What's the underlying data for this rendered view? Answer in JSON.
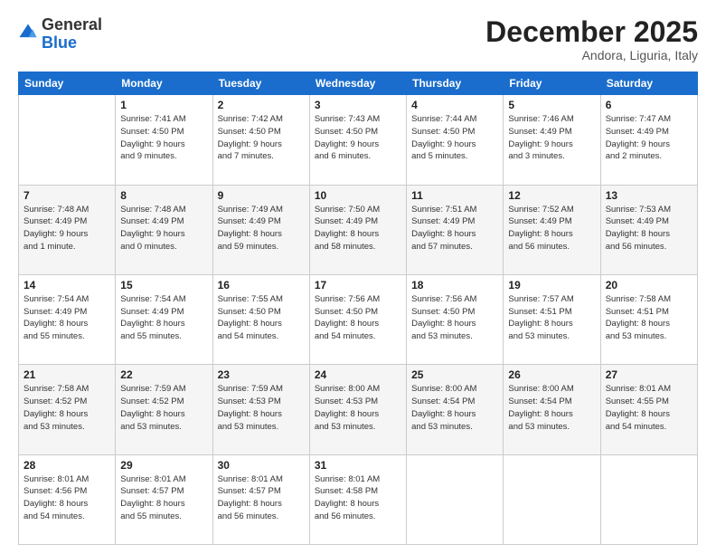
{
  "header": {
    "logo": {
      "general": "General",
      "blue": "Blue"
    },
    "title": "December 2025",
    "subtitle": "Andora, Liguria, Italy"
  },
  "calendar": {
    "days_of_week": [
      "Sunday",
      "Monday",
      "Tuesday",
      "Wednesday",
      "Thursday",
      "Friday",
      "Saturday"
    ],
    "weeks": [
      [
        {
          "day": "",
          "info": ""
        },
        {
          "day": "1",
          "info": "Sunrise: 7:41 AM\nSunset: 4:50 PM\nDaylight: 9 hours\nand 9 minutes."
        },
        {
          "day": "2",
          "info": "Sunrise: 7:42 AM\nSunset: 4:50 PM\nDaylight: 9 hours\nand 7 minutes."
        },
        {
          "day": "3",
          "info": "Sunrise: 7:43 AM\nSunset: 4:50 PM\nDaylight: 9 hours\nand 6 minutes."
        },
        {
          "day": "4",
          "info": "Sunrise: 7:44 AM\nSunset: 4:50 PM\nDaylight: 9 hours\nand 5 minutes."
        },
        {
          "day": "5",
          "info": "Sunrise: 7:46 AM\nSunset: 4:49 PM\nDaylight: 9 hours\nand 3 minutes."
        },
        {
          "day": "6",
          "info": "Sunrise: 7:47 AM\nSunset: 4:49 PM\nDaylight: 9 hours\nand 2 minutes."
        }
      ],
      [
        {
          "day": "7",
          "info": "Sunrise: 7:48 AM\nSunset: 4:49 PM\nDaylight: 9 hours\nand 1 minute."
        },
        {
          "day": "8",
          "info": "Sunrise: 7:48 AM\nSunset: 4:49 PM\nDaylight: 9 hours\nand 0 minutes."
        },
        {
          "day": "9",
          "info": "Sunrise: 7:49 AM\nSunset: 4:49 PM\nDaylight: 8 hours\nand 59 minutes."
        },
        {
          "day": "10",
          "info": "Sunrise: 7:50 AM\nSunset: 4:49 PM\nDaylight: 8 hours\nand 58 minutes."
        },
        {
          "day": "11",
          "info": "Sunrise: 7:51 AM\nSunset: 4:49 PM\nDaylight: 8 hours\nand 57 minutes."
        },
        {
          "day": "12",
          "info": "Sunrise: 7:52 AM\nSunset: 4:49 PM\nDaylight: 8 hours\nand 56 minutes."
        },
        {
          "day": "13",
          "info": "Sunrise: 7:53 AM\nSunset: 4:49 PM\nDaylight: 8 hours\nand 56 minutes."
        }
      ],
      [
        {
          "day": "14",
          "info": "Sunrise: 7:54 AM\nSunset: 4:49 PM\nDaylight: 8 hours\nand 55 minutes."
        },
        {
          "day": "15",
          "info": "Sunrise: 7:54 AM\nSunset: 4:49 PM\nDaylight: 8 hours\nand 55 minutes."
        },
        {
          "day": "16",
          "info": "Sunrise: 7:55 AM\nSunset: 4:50 PM\nDaylight: 8 hours\nand 54 minutes."
        },
        {
          "day": "17",
          "info": "Sunrise: 7:56 AM\nSunset: 4:50 PM\nDaylight: 8 hours\nand 54 minutes."
        },
        {
          "day": "18",
          "info": "Sunrise: 7:56 AM\nSunset: 4:50 PM\nDaylight: 8 hours\nand 53 minutes."
        },
        {
          "day": "19",
          "info": "Sunrise: 7:57 AM\nSunset: 4:51 PM\nDaylight: 8 hours\nand 53 minutes."
        },
        {
          "day": "20",
          "info": "Sunrise: 7:58 AM\nSunset: 4:51 PM\nDaylight: 8 hours\nand 53 minutes."
        }
      ],
      [
        {
          "day": "21",
          "info": "Sunrise: 7:58 AM\nSunset: 4:52 PM\nDaylight: 8 hours\nand 53 minutes."
        },
        {
          "day": "22",
          "info": "Sunrise: 7:59 AM\nSunset: 4:52 PM\nDaylight: 8 hours\nand 53 minutes."
        },
        {
          "day": "23",
          "info": "Sunrise: 7:59 AM\nSunset: 4:53 PM\nDaylight: 8 hours\nand 53 minutes."
        },
        {
          "day": "24",
          "info": "Sunrise: 8:00 AM\nSunset: 4:53 PM\nDaylight: 8 hours\nand 53 minutes."
        },
        {
          "day": "25",
          "info": "Sunrise: 8:00 AM\nSunset: 4:54 PM\nDaylight: 8 hours\nand 53 minutes."
        },
        {
          "day": "26",
          "info": "Sunrise: 8:00 AM\nSunset: 4:54 PM\nDaylight: 8 hours\nand 53 minutes."
        },
        {
          "day": "27",
          "info": "Sunrise: 8:01 AM\nSunset: 4:55 PM\nDaylight: 8 hours\nand 54 minutes."
        }
      ],
      [
        {
          "day": "28",
          "info": "Sunrise: 8:01 AM\nSunset: 4:56 PM\nDaylight: 8 hours\nand 54 minutes."
        },
        {
          "day": "29",
          "info": "Sunrise: 8:01 AM\nSunset: 4:57 PM\nDaylight: 8 hours\nand 55 minutes."
        },
        {
          "day": "30",
          "info": "Sunrise: 8:01 AM\nSunset: 4:57 PM\nDaylight: 8 hours\nand 56 minutes."
        },
        {
          "day": "31",
          "info": "Sunrise: 8:01 AM\nSunset: 4:58 PM\nDaylight: 8 hours\nand 56 minutes."
        },
        {
          "day": "",
          "info": ""
        },
        {
          "day": "",
          "info": ""
        },
        {
          "day": "",
          "info": ""
        }
      ]
    ]
  }
}
